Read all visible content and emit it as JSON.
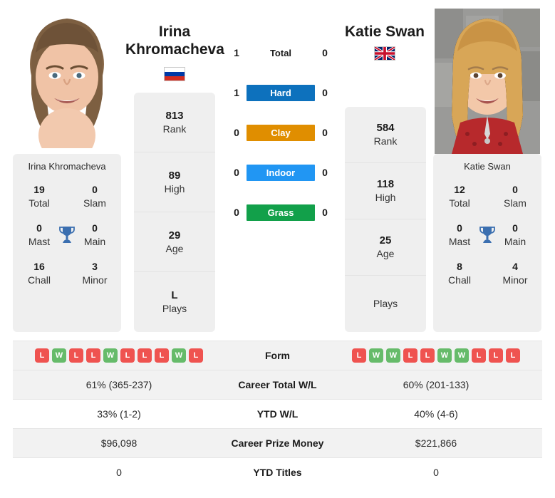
{
  "players": {
    "left": {
      "name": "Irina Khromacheva",
      "name_line1": "Irina",
      "name_line2": "Khromacheva",
      "country": "Russia",
      "flag_icon": "flag-russia-icon",
      "photo_alt": "Irina Khromacheva headshot",
      "attributes": [
        {
          "value": "813",
          "label": "Rank"
        },
        {
          "value": "89",
          "label": "High"
        },
        {
          "value": "29",
          "label": "Age"
        },
        {
          "value": "L",
          "label": "Plays"
        }
      ],
      "titles": {
        "heading": "Irina Khromacheva",
        "rows": [
          [
            {
              "value": "19",
              "label": "Total"
            },
            {
              "value": "0",
              "label": "Slam"
            }
          ],
          [
            {
              "value": "0",
              "label": "Mast"
            },
            {
              "value": "0",
              "label": "Main"
            }
          ],
          [
            {
              "value": "16",
              "label": "Chall"
            },
            {
              "value": "3",
              "label": "Minor"
            }
          ]
        ]
      },
      "form": [
        "L",
        "W",
        "L",
        "L",
        "W",
        "L",
        "L",
        "L",
        "W",
        "L"
      ],
      "stats": {
        "career_wl": "61% (365-237)",
        "ytd_wl": "33% (1-2)",
        "career_prize": "$96,098",
        "ytd_titles": "0"
      }
    },
    "right": {
      "name": "Katie Swan",
      "name_line1": "Katie Swan",
      "name_line2": "",
      "country": "United Kingdom",
      "flag_icon": "flag-uk-icon",
      "photo_alt": "Katie Swan headshot",
      "attributes": [
        {
          "value": "584",
          "label": "Rank"
        },
        {
          "value": "118",
          "label": "High"
        },
        {
          "value": "25",
          "label": "Age"
        },
        {
          "value": "",
          "label": "Plays"
        }
      ],
      "titles": {
        "heading": "Katie Swan",
        "rows": [
          [
            {
              "value": "12",
              "label": "Total"
            },
            {
              "value": "0",
              "label": "Slam"
            }
          ],
          [
            {
              "value": "0",
              "label": "Mast"
            },
            {
              "value": "0",
              "label": "Main"
            }
          ],
          [
            {
              "value": "8",
              "label": "Chall"
            },
            {
              "value": "4",
              "label": "Minor"
            }
          ]
        ]
      },
      "form": [
        "L",
        "W",
        "W",
        "L",
        "L",
        "W",
        "W",
        "L",
        "L",
        "L"
      ],
      "stats": {
        "career_wl": "60% (201-133)",
        "ytd_wl": "40% (4-6)",
        "career_prize": "$221,866",
        "ytd_titles": "0"
      }
    }
  },
  "head_to_head": [
    {
      "label": "Total",
      "left": "1",
      "right": "0",
      "color": "transparent",
      "plain": true
    },
    {
      "label": "Hard",
      "left": "1",
      "right": "0",
      "color": "#0d71bd",
      "plain": false
    },
    {
      "label": "Clay",
      "left": "0",
      "right": "0",
      "color": "#e08e00",
      "plain": false
    },
    {
      "label": "Indoor",
      "left": "0",
      "right": "0",
      "color": "#2196f3",
      "plain": false
    },
    {
      "label": "Grass",
      "left": "0",
      "right": "0",
      "color": "#12a04a",
      "plain": false
    }
  ],
  "stats_table": {
    "rows": [
      {
        "label": "Form",
        "kind": "form"
      },
      {
        "label": "Career Total W/L",
        "kind": "text",
        "key": "career_wl"
      },
      {
        "label": "YTD W/L",
        "kind": "text",
        "key": "ytd_wl"
      },
      {
        "label": "Career Prize Money",
        "kind": "text",
        "key": "career_prize"
      },
      {
        "label": "YTD Titles",
        "kind": "text",
        "key": "ytd_titles"
      }
    ]
  },
  "colors": {
    "win": "#66bb6a",
    "loss": "#ef5350",
    "card_bg": "#efefef",
    "row_alt": "#f2f2f2",
    "trophy": "#3b6fb0"
  }
}
